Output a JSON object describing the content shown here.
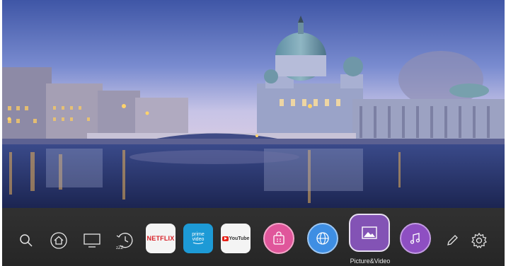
{
  "launcher": {
    "system_items": [
      {
        "icon": "search-icon"
      },
      {
        "icon": "home-icon"
      },
      {
        "icon": "tv-input-icon"
      },
      {
        "icon": "sleep-timer-icon",
        "caption": "zZZ"
      }
    ],
    "apps": {
      "netflix": {
        "label": "NETFLIX",
        "color": "#d81f26"
      },
      "prime_video": {
        "line1": "prime",
        "line2": "video",
        "color": "#1d9ad6"
      },
      "youtube": {
        "label": "YouTube",
        "color": "#e62117"
      }
    },
    "store": {
      "icon": "store-bag-icon",
      "color": "#e0569b"
    },
    "browser": {
      "icon": "globe-icon",
      "color": "#3e8ee3"
    },
    "picture_video": {
      "icon": "image-icon",
      "label": "Picture&Video",
      "color": "#8353b5"
    },
    "music": {
      "icon": "music-note-icon",
      "color": "#8e4fc2"
    },
    "edit": {
      "icon": "pencil-icon"
    },
    "settings": {
      "icon": "gear-icon"
    }
  }
}
